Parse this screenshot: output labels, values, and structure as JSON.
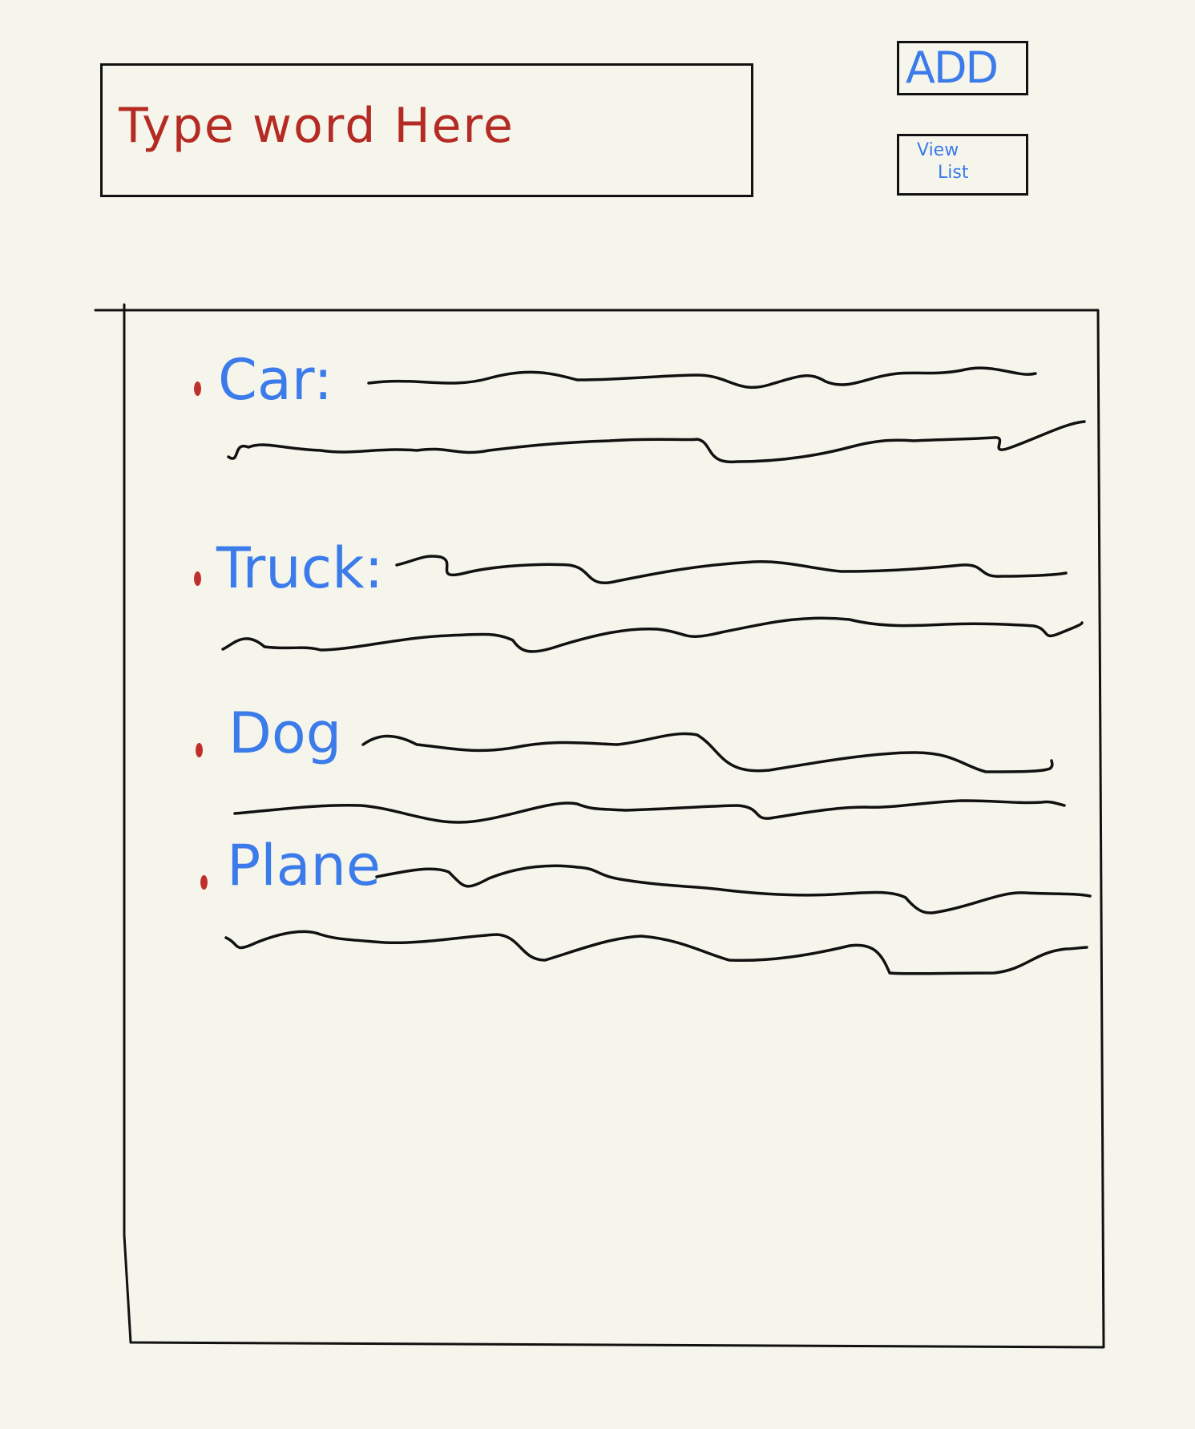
{
  "search": {
    "placeholder": "Type word Here",
    "value": ""
  },
  "toolbar": {
    "add_label": "ADD",
    "view_list_line1": "View",
    "view_list_line2": "List"
  },
  "word_list": {
    "items": [
      {
        "word": "Car:"
      },
      {
        "word": "Truck:"
      },
      {
        "word": "Dog"
      },
      {
        "word": "Plane"
      }
    ]
  },
  "colors": {
    "background": "#f6f5ec",
    "ink": "#111111",
    "accent_blue": "#3b7bea",
    "accent_red": "#b42b24"
  }
}
